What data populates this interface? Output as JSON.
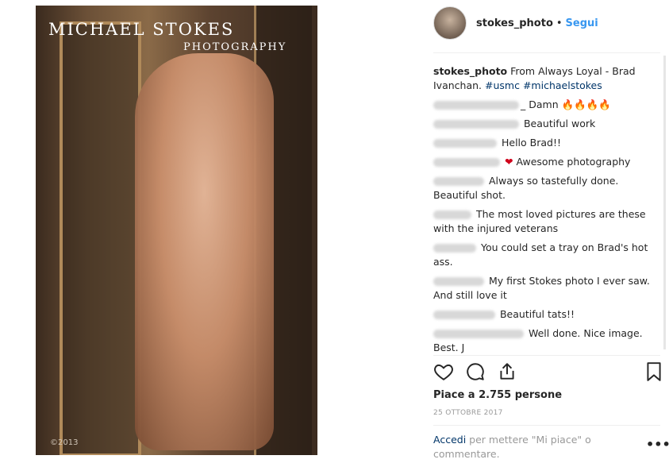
{
  "post": {
    "photo_title": "MICHAEL STOKES",
    "photo_subtitle": "PHOTOGRAPHY",
    "photo_year": "©2013"
  },
  "header": {
    "username": "stokes_photo",
    "separator": "•",
    "follow_label": "Segui"
  },
  "caption": {
    "username": "stokes_photo",
    "text": " From Always Loyal - Brad Ivanchan. ",
    "tag1": "#usmc",
    "tag2": "#michaelstokes"
  },
  "comments": [
    {
      "text": "Damn ",
      "emoji": "🔥🔥🔥🔥"
    },
    {
      "text": "Beautiful work"
    },
    {
      "text": "Hello Brad!!"
    },
    {
      "text": " Awesome photography",
      "emoji": "❤"
    },
    {
      "text": "Always so tastefully done. Beautiful shot."
    },
    {
      "text": "The most loved pictures are these with the injured veterans"
    },
    {
      "text": "You could set a tray on Brad's hot ass."
    },
    {
      "text": "My first Stokes photo I ever saw. And still love it"
    },
    {
      "text": "Beautiful tats!!"
    },
    {
      "text": "Well done. Nice image. Best. J"
    }
  ],
  "likes_text": "Piace a 2.755 persone",
  "date_text": "25 OTTOBRE 2017",
  "login": {
    "link": "Accedi",
    "rest": " per mettere \"Mi piace\" o commentare."
  },
  "more_label": "•••",
  "colors": {
    "link_blue": "#3897f0",
    "tag_blue": "#003569",
    "text": "#262626",
    "muted": "#999999"
  }
}
